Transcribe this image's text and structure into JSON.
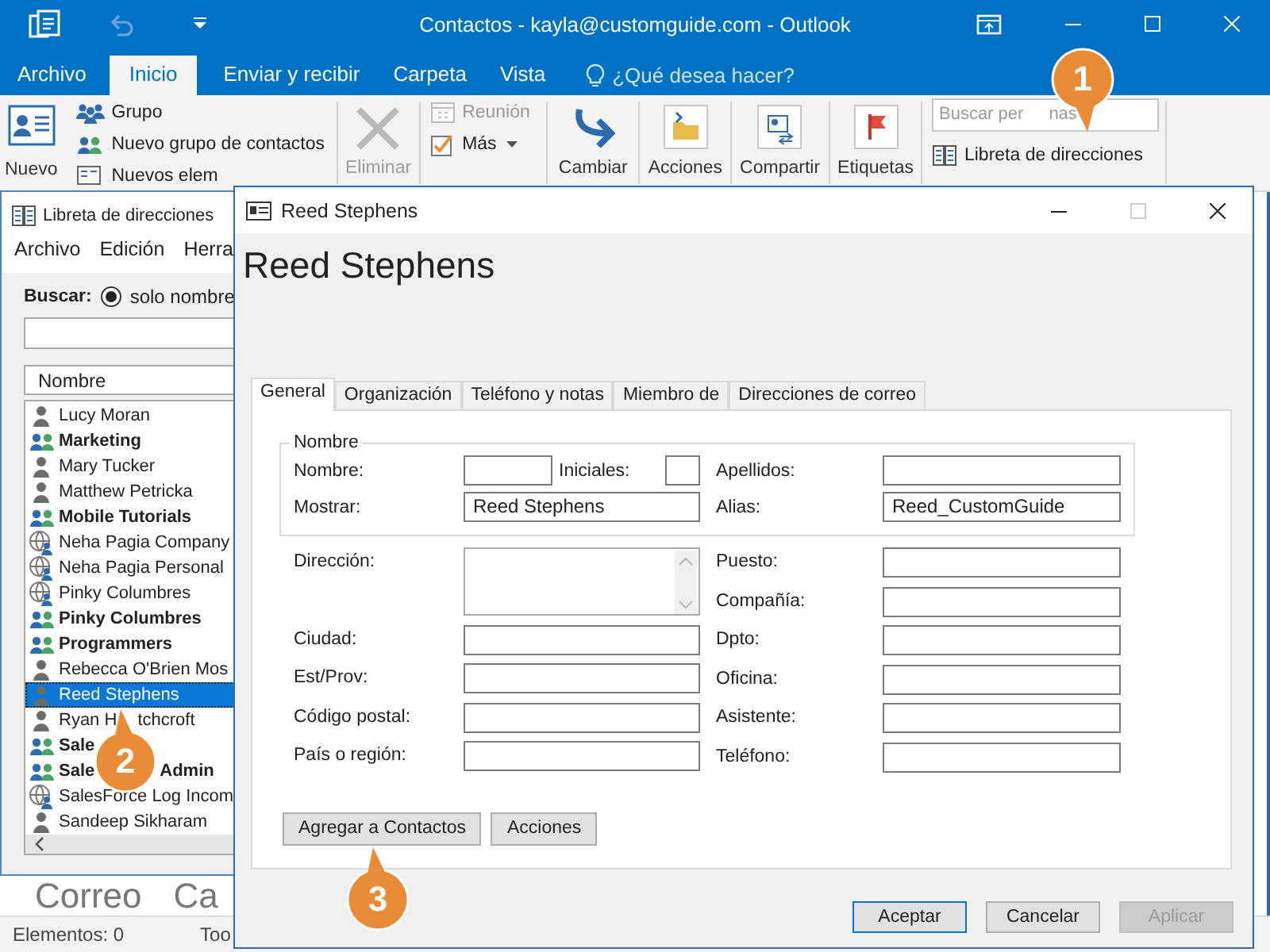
{
  "window": {
    "title": "Contactos - kayla@customguide.com - Outlook"
  },
  "ribbon_tabs": [
    {
      "label": "Archivo",
      "selected": false
    },
    {
      "label": "Inicio",
      "selected": true
    },
    {
      "label": "Enviar y recibir",
      "selected": false
    },
    {
      "label": "Carpeta",
      "selected": false
    },
    {
      "label": "Vista",
      "selected": false
    }
  ],
  "tell_me": {
    "placeholder": "¿Qué desea hacer?"
  },
  "ribbon": {
    "new": {
      "label": "Nuevo"
    },
    "new_items": [
      {
        "label": "Grupo",
        "kind": "group"
      },
      {
        "label": "Nuevo grupo de contactos",
        "kind": "contact-group"
      },
      {
        "label": "Nuevos elem",
        "kind": "items"
      }
    ],
    "delete": {
      "label": "Eliminar",
      "disabled": true
    },
    "respond": [
      {
        "label": "Reunión",
        "kind": "meeting",
        "disabled": true
      },
      {
        "label": "Más",
        "kind": "more",
        "disabled": false
      }
    ],
    "big_buttons": [
      {
        "label": "Cambiar",
        "kind": "change"
      },
      {
        "label": "Acciones",
        "kind": "actions"
      },
      {
        "label": "Compartir",
        "kind": "share"
      },
      {
        "label": "Etiquetas",
        "kind": "tags"
      }
    ],
    "search": {
      "placeholder": "Buscar per",
      "placeholder_rest": "nas"
    },
    "address_book": {
      "label": "Libreta de direcciones"
    }
  },
  "navigation": [
    "Correo",
    "Ca"
  ],
  "status_bar": [
    "Elementos: 0",
    "Too"
  ],
  "address_book_window": {
    "title": "Libreta de direcciones",
    "menu": [
      "Archivo",
      "Edición",
      "Herra"
    ],
    "search_label": "Buscar:",
    "search_mode": {
      "label": "solo nombre",
      "selected": true
    },
    "column": "Nombre",
    "entries": [
      {
        "name": "Lucy Moran",
        "kind": "person",
        "selected": false
      },
      {
        "name": "Marketing",
        "kind": "group",
        "selected": false
      },
      {
        "name": "Mary Tucker",
        "kind": "person",
        "selected": false
      },
      {
        "name": "Matthew Petricka",
        "kind": "person",
        "selected": false
      },
      {
        "name": "Mobile Tutorials",
        "kind": "group",
        "selected": false
      },
      {
        "name": "Neha Pagia Company",
        "kind": "web",
        "selected": false
      },
      {
        "name": "Neha Pagia Personal",
        "kind": "web",
        "selected": false
      },
      {
        "name": "Pinky Columbres",
        "kind": "web",
        "selected": false
      },
      {
        "name": "Pinky Columbres",
        "kind": "group",
        "selected": false
      },
      {
        "name": "Programmers",
        "kind": "group",
        "selected": false
      },
      {
        "name": "Rebecca O'Brien Mos",
        "kind": "person",
        "selected": false
      },
      {
        "name": "Reed Stephens",
        "kind": "person",
        "selected": true
      },
      {
        "name": "Ryan H",
        "rest": "tchcroft",
        "kind": "person",
        "selected": false
      },
      {
        "name": "Sale",
        "kind": "group",
        "selected": false
      },
      {
        "name": "Sale",
        "rest": "Admin",
        "kind": "group",
        "selected": false
      },
      {
        "name": "SalesForce Log Incom",
        "kind": "web",
        "selected": false
      },
      {
        "name": "Sandeep Sikharam",
        "kind": "person",
        "selected": false
      }
    ]
  },
  "dialog": {
    "title": "Reed Stephens",
    "heading": "Reed Stephens",
    "tabs": [
      {
        "label": "General",
        "selected": true
      },
      {
        "label": "Organización",
        "selected": false
      },
      {
        "label": "Teléfono y notas",
        "selected": false
      },
      {
        "label": "Miembro de",
        "selected": false
      },
      {
        "label": "Direcciones de correo",
        "selected": false
      }
    ],
    "name_group": {
      "legend": "Nombre",
      "first_name": {
        "label": "Nombre:"
      },
      "initials": {
        "label": "Iniciales:"
      },
      "last_name": {
        "label": "Apellidos:"
      },
      "display": {
        "label": "Mostrar:",
        "value": "Reed Stephens"
      },
      "alias": {
        "label": "Alias:",
        "value": "Reed_CustomGuide"
      }
    },
    "left_fields": [
      {
        "label": "Dirección:",
        "kind": "multiline"
      },
      {
        "label": "Ciudad:",
        "kind": "text"
      },
      {
        "label": "Est/Prov:",
        "kind": "text"
      },
      {
        "label": "Código postal:",
        "kind": "text"
      },
      {
        "label": "País o región:",
        "kind": "text"
      }
    ],
    "right_fields": [
      {
        "label": "Puesto:",
        "kind": "text"
      },
      {
        "label": "Compañía:",
        "kind": "text"
      },
      {
        "label": "Dpto:",
        "kind": "text"
      },
      {
        "label": "Oficina:",
        "kind": "text"
      },
      {
        "label": "Asistente:",
        "kind": "text"
      },
      {
        "label": "Teléfono:",
        "kind": "text"
      }
    ],
    "actions": [
      "Agregar a Contactos",
      "Acciones"
    ],
    "buttons": [
      {
        "label": "Aceptar",
        "kind": "default",
        "disabled": false
      },
      {
        "label": "Cancelar",
        "kind": "normal",
        "disabled": false
      },
      {
        "label": "Aplicar",
        "kind": "normal",
        "disabled": true
      }
    ]
  },
  "callouts": [
    {
      "number": "1",
      "pointer_up": false
    },
    {
      "number": "2",
      "pointer_up": true
    },
    {
      "number": "3",
      "pointer_up": true
    }
  ]
}
